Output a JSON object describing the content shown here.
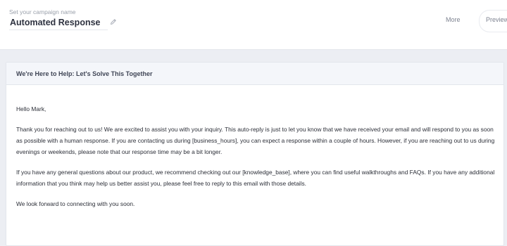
{
  "header": {
    "campaign_label": "Set your campaign name",
    "campaign_name": "Automated Response",
    "edit_icon": "pencil-icon",
    "actions": {
      "more": "More",
      "preview": "Preview"
    }
  },
  "email": {
    "subject": "We're Here to Help: Let's Solve This Together",
    "greeting": "Hello Mark,",
    "paragraph_1": "Thank you for reaching out to us! We are excited to assist you with your inquiry. This auto-reply is just to let you know that we have received your email and will respond to you as soon as possible with a human response. If you are contacting us during [business_hours], you can expect a response within a couple of hours. However, if you are reaching out to us during evenings or weekends, please note that our response time may be a bit longer.",
    "paragraph_2": "If you have any general questions about our product, we recommend checking out our [knowledge_base], where you can find useful walkthroughs and FAQs. If you have any additional information that you think may help us better assist you, please feel free to reply to this email with those details.",
    "closing": "We look forward to connecting with you soon."
  },
  "colors": {
    "page_background": "#eceef3",
    "subject_bar": "#f4f6fa",
    "title_text": "#2e3240"
  }
}
